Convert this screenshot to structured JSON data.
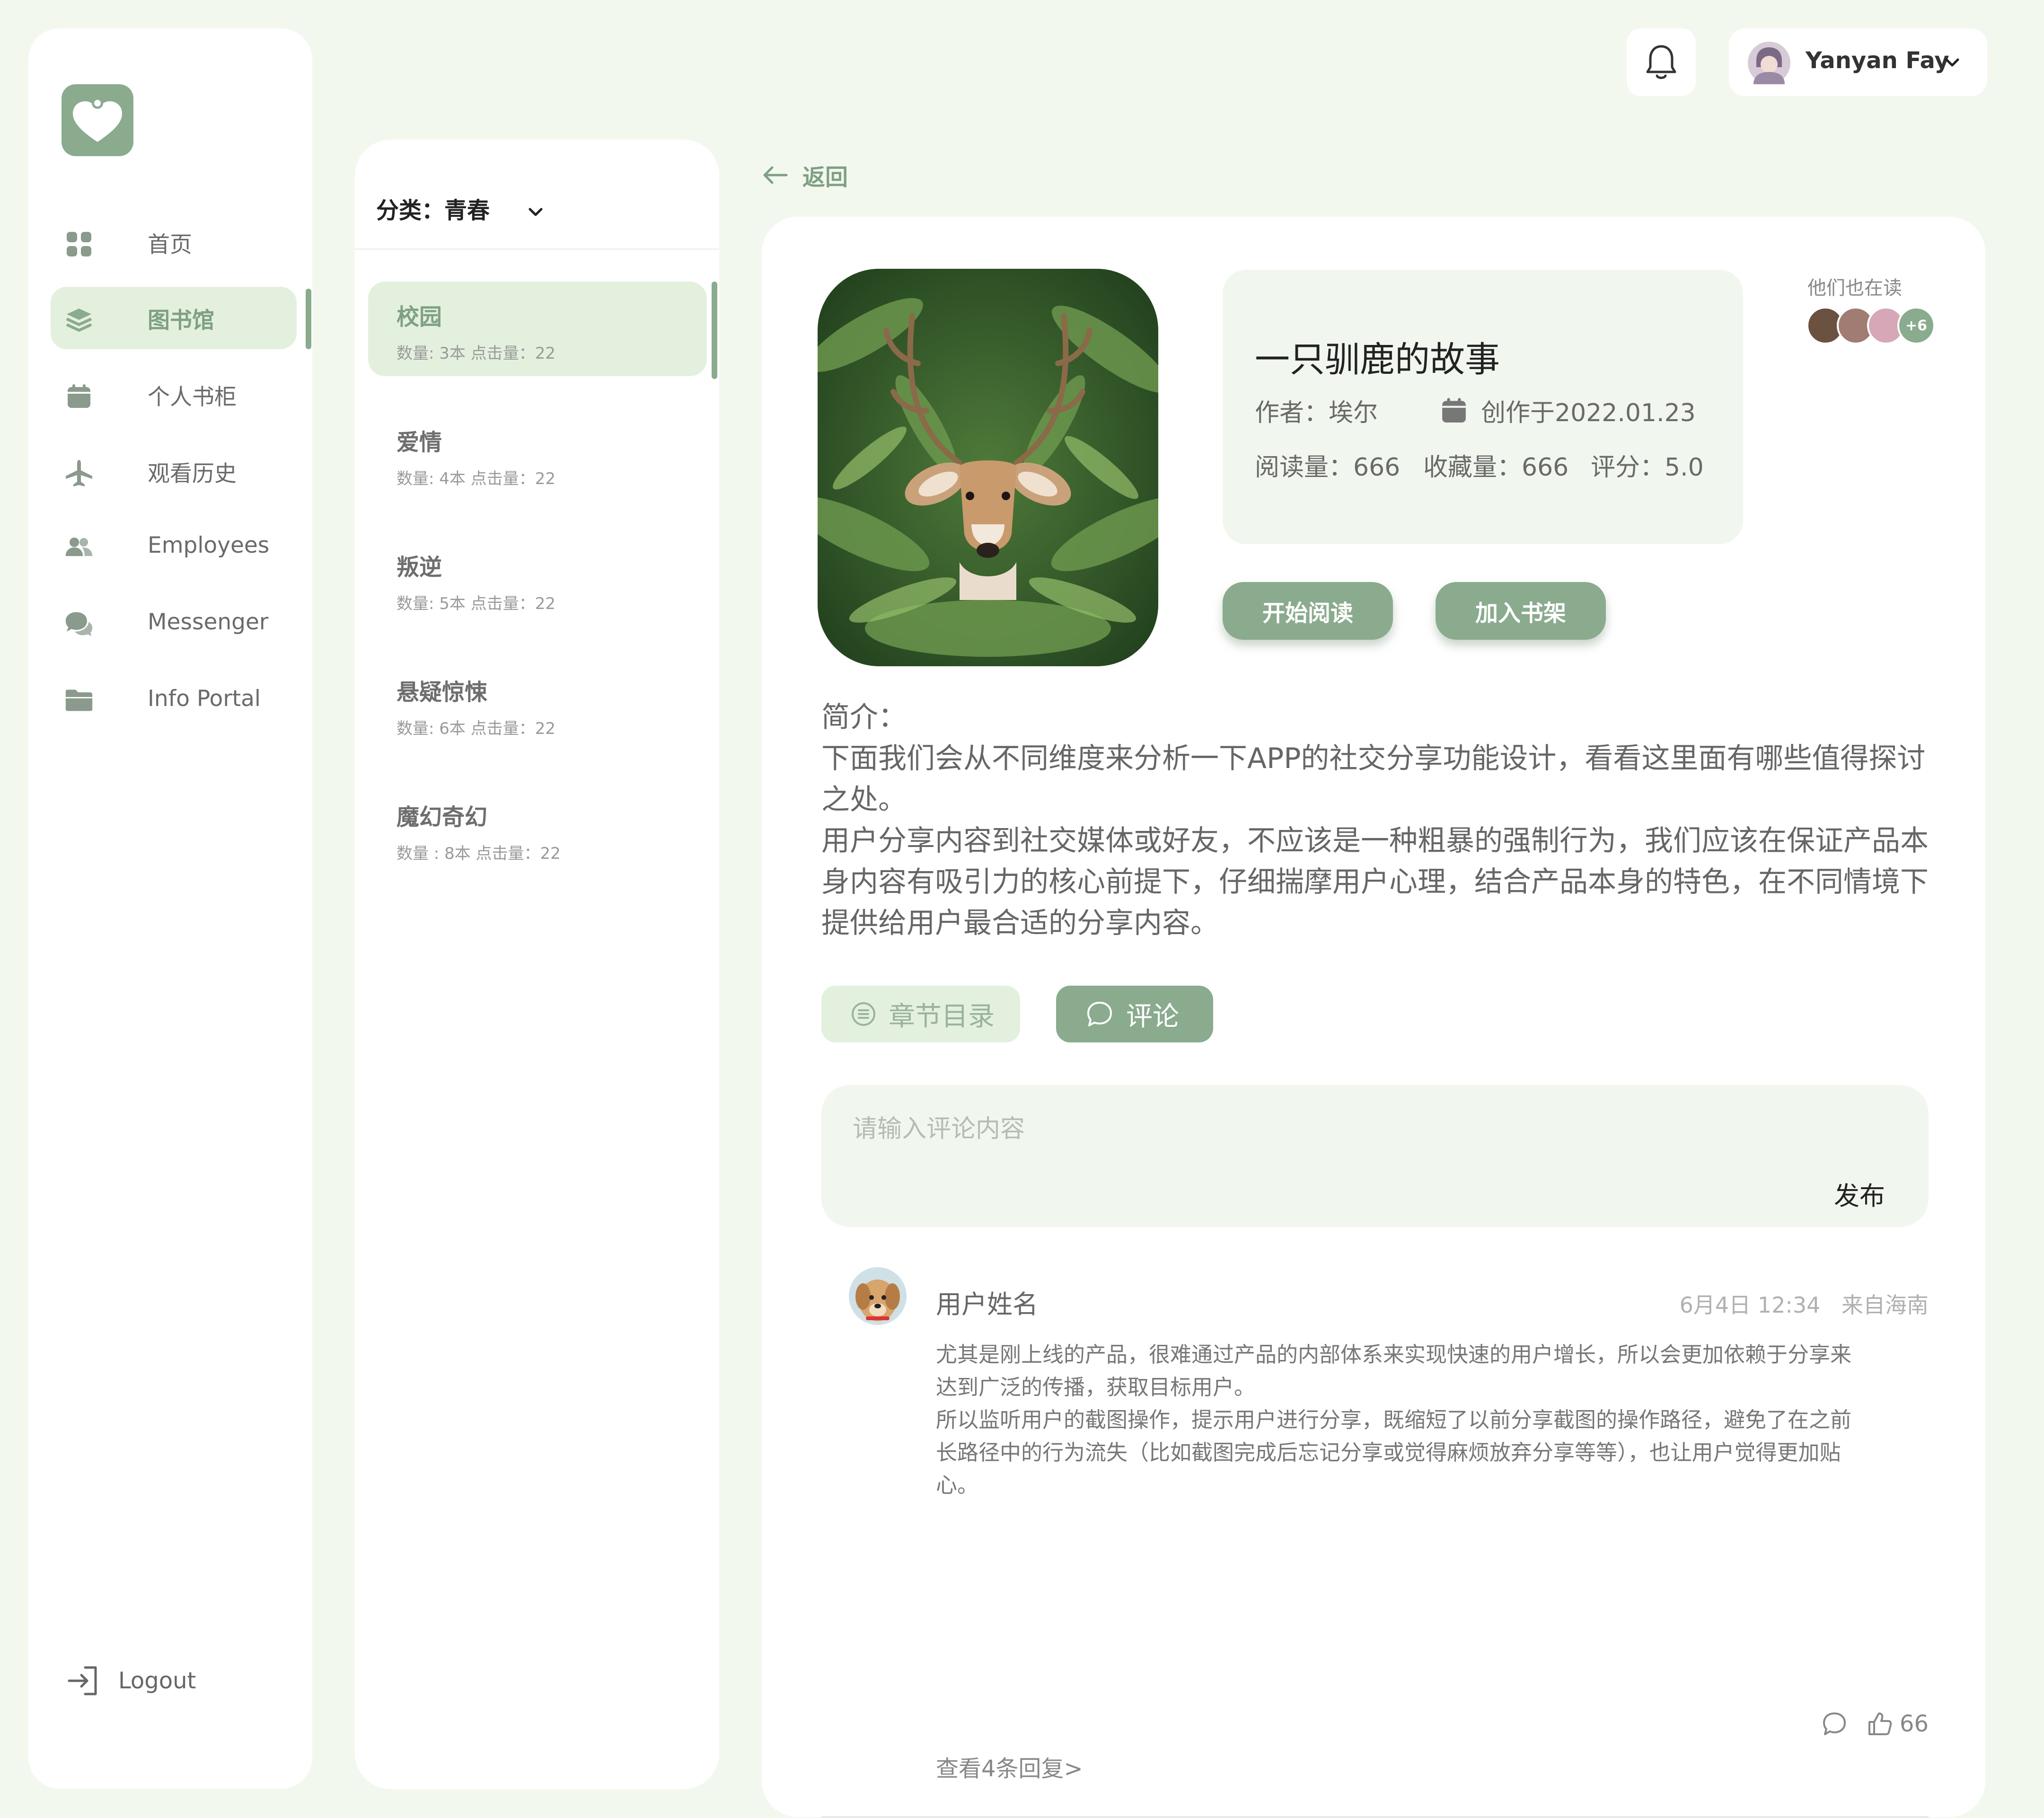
{
  "colors": {
    "accent": "#8aab8e",
    "accent_light": "#e4f0de",
    "panel_bg": "#f1f7ee",
    "page_bg": "#f3f8ef"
  },
  "sidebar": {
    "items": [
      {
        "label": "首页",
        "icon": "grid-icon",
        "active": false
      },
      {
        "label": "图书馆",
        "icon": "layers-icon",
        "active": true
      },
      {
        "label": "个人书柜",
        "icon": "calendar-icon",
        "active": false
      },
      {
        "label": "观看历史",
        "icon": "airplane-icon",
        "active": false
      },
      {
        "label": "Employees",
        "icon": "users-icon",
        "active": false
      },
      {
        "label": "Messenger",
        "icon": "chat-icon",
        "active": false
      },
      {
        "label": "Info Portal",
        "icon": "folder-icon",
        "active": false
      }
    ],
    "logout_label": "Logout"
  },
  "category": {
    "header": "分类：青春",
    "items": [
      {
        "name": "校园",
        "meta": "数量: 3本  点击量：22",
        "active": true
      },
      {
        "name": "爱情",
        "meta": "数量: 4本  点击量：22",
        "active": false
      },
      {
        "name": "叛逆",
        "meta": "数量: 5本  点击量：22",
        "active": false
      },
      {
        "name": "悬疑惊悚",
        "meta": "数量: 6本  点击量：22",
        "active": false
      },
      {
        "name": "魔幻奇幻",
        "meta": "数量 : 8本  点击量：22",
        "active": false
      }
    ]
  },
  "header": {
    "username": "Yanyan Fay"
  },
  "back_label": "返回",
  "book": {
    "title": "一只驯鹿的故事",
    "author": "作者：埃尔",
    "created": "创作于2022.01.23",
    "reads": "阅读量：666",
    "favorites": "收藏量：666",
    "rating": "评分：5.0",
    "start_reading": "开始阅读",
    "add_shelf": "加入书架",
    "readers_label": "他们也在读",
    "readers_more": "+6"
  },
  "intro": {
    "lines": [
      "简介：",
      "下面我们会从不同维度来分析一下APP的社交分享功能设计，看看这里面有哪些值得探讨",
      "之处。",
      "用户分享内容到社交媒体或好友，不应该是一种粗暴的强制行为，我们应该在保证产品本",
      "身内容有吸引力的核心前提下，仔细揣摩用户心理，结合产品本身的特色，在不同情境下",
      "提供给用户最合适的分享内容。"
    ]
  },
  "tabs": {
    "chapters": "章节目录",
    "comments": "评论"
  },
  "comment_input": {
    "placeholder": "请输入评论内容",
    "publish": "发布"
  },
  "comment": {
    "user": "用户姓名",
    "time": "6月4日 12:34",
    "location": "来自海南",
    "lines": [
      "尤其是刚上线的产品，很难通过产品的内部体系来实现快速的用户增长，所以会更加依赖于分享来",
      "达到广泛的传播，获取目标用户。",
      "所以监听用户的截图操作，提示用户进行分享，既缩短了以前分享截图的操作路径，避免了在之前",
      "长路径中的行为流失（比如截图完成后忘记分享或觉得麻烦放弃分享等等），也让用户觉得更加贴",
      "心。"
    ],
    "likes": "66",
    "replies": "查看4条回复>"
  }
}
